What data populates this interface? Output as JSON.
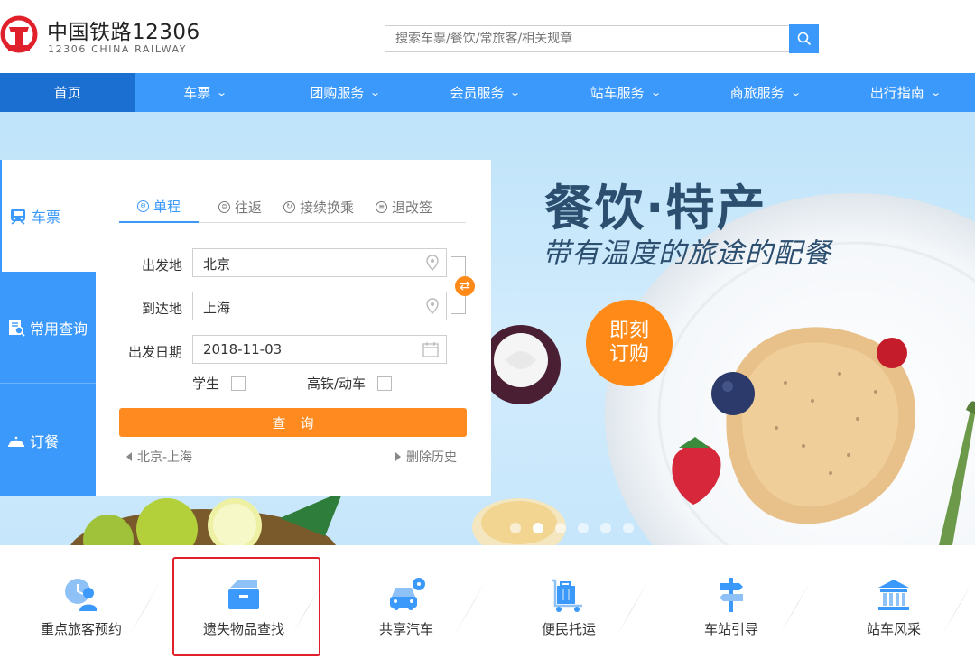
{
  "header": {
    "brand_cn": "中国铁路12306",
    "brand_en": "12306 CHINA RAILWAY",
    "search_placeholder": "搜索车票/餐饮/常旅客/相关规章"
  },
  "nav": {
    "items": [
      {
        "label": "首页",
        "dropdown": false
      },
      {
        "label": "车票",
        "dropdown": true
      },
      {
        "label": "团购服务",
        "dropdown": true
      },
      {
        "label": "会员服务",
        "dropdown": true
      },
      {
        "label": "站车服务",
        "dropdown": true
      },
      {
        "label": "商旅服务",
        "dropdown": true
      },
      {
        "label": "出行指南",
        "dropdown": true
      }
    ],
    "chevron": "⌄"
  },
  "side_tabs": [
    {
      "label": "车票",
      "icon": "train-icon"
    },
    {
      "label": "常用查询",
      "icon": "document-search-icon"
    },
    {
      "label": "订餐",
      "icon": "meal-cloche-icon"
    }
  ],
  "trip_tabs": [
    {
      "label": "单程",
      "icon": "⊖"
    },
    {
      "label": "往返",
      "icon": "⊜"
    },
    {
      "label": "接续换乘",
      "icon": "↻"
    },
    {
      "label": "退改签",
      "icon": "≡"
    }
  ],
  "form": {
    "from_label": "出发地",
    "from_value": "北京",
    "to_label": "到达地",
    "to_value": "上海",
    "date_label": "出发日期",
    "date_value": "2018-11-03",
    "student_label": "学生",
    "highspeed_label": "高铁/动车",
    "query_label": "查询",
    "history_item": "北京-上海",
    "delete_history": "删除历史",
    "swap_glyph": "⇄"
  },
  "banner": {
    "title": "餐饮·特产",
    "subtitle": "带有温度的旅途的配餐",
    "cta_line1": "即刻",
    "cta_line2": "订购"
  },
  "services": [
    {
      "label": "重点旅客预约",
      "icon": "priority-passenger-icon"
    },
    {
      "label": "遗失物品查找",
      "icon": "lost-found-icon"
    },
    {
      "label": "共享汽车",
      "icon": "shared-car-icon"
    },
    {
      "label": "便民托运",
      "icon": "luggage-cart-icon"
    },
    {
      "label": "车站引导",
      "icon": "signpost-icon"
    },
    {
      "label": "站车风采",
      "icon": "station-building-icon"
    }
  ],
  "colors": {
    "primary": "#3b99fc",
    "nav_active": "#1a6fd1",
    "accent_orange": "#ff8a1f",
    "highlight_red": "#e0202a"
  }
}
